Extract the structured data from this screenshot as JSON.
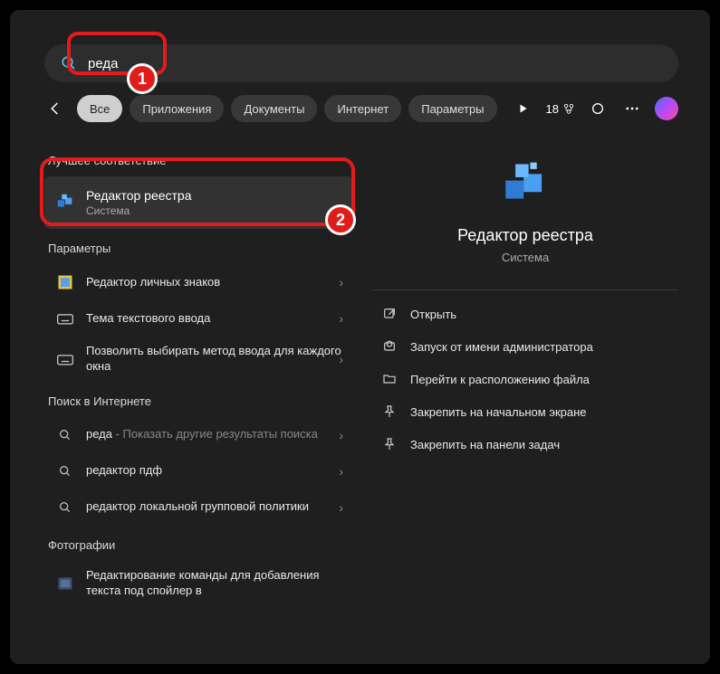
{
  "search": {
    "query": "реда"
  },
  "tabs": [
    "Все",
    "Приложения",
    "Документы",
    "Интернет",
    "Параметры"
  ],
  "points": "18",
  "sections": {
    "best": "Лучшее соответствие",
    "params": "Параметры",
    "web": "Поиск в Интернете",
    "photos": "Фотографии"
  },
  "best": {
    "title": "Редактор реестра",
    "subtitle": "Система"
  },
  "params_items": [
    {
      "label": "Редактор личных знаков"
    },
    {
      "label": "Тема текстового ввода"
    },
    {
      "label": "Позволить выбирать метод ввода для каждого окна"
    }
  ],
  "web_items": [
    {
      "prefix": "реда",
      "suffix": " - Показать другие результаты поиска"
    },
    {
      "prefix": "редактор пдф",
      "suffix": ""
    },
    {
      "prefix": "редактор локальной групповой политики",
      "suffix": ""
    }
  ],
  "photo_item": {
    "label": "Редактирование команды для добавления текста под спойлер в"
  },
  "detail": {
    "title": "Редактор реестра",
    "subtitle": "Система"
  },
  "actions": [
    "Открыть",
    "Запуск от имени администратора",
    "Перейти к расположению файла",
    "Закрепить на начальном экране",
    "Закрепить на панели задач"
  ],
  "badges": {
    "one": "1",
    "two": "2"
  }
}
